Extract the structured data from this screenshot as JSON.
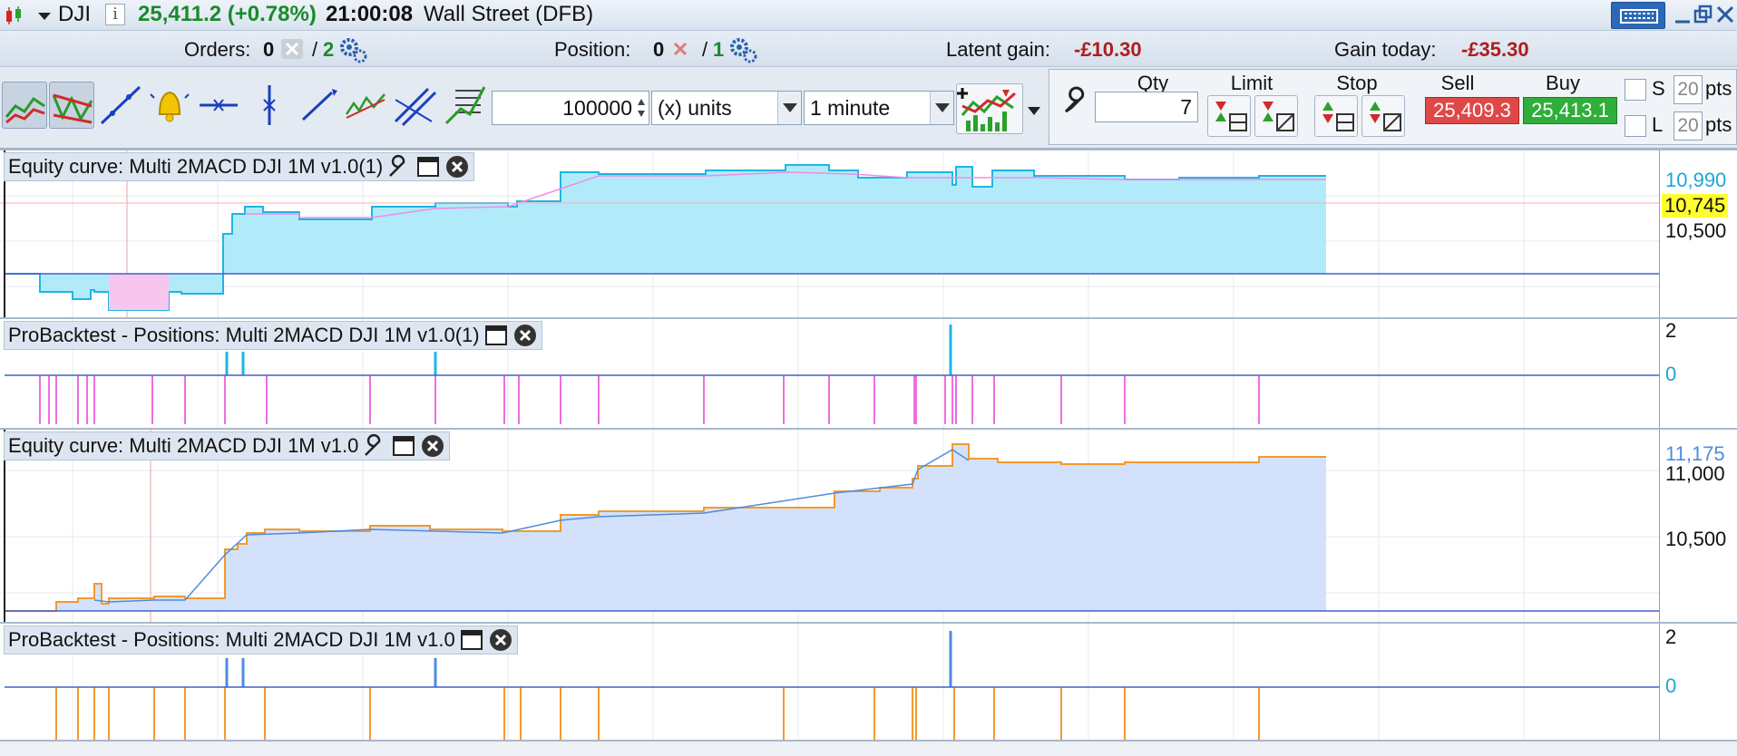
{
  "titlebar": {
    "symbol": "DJI",
    "price_change": "25,411.2 (+0.78%)",
    "time": "21:00:08",
    "market": "Wall Street (DFB)"
  },
  "infobar": {
    "orders_label": "Orders:",
    "orders_value": "0",
    "orders_sep": "/",
    "orders_auto": "2",
    "position_label": "Position:",
    "position_value": "0",
    "position_sep": "/",
    "position_auto": "1",
    "latent_label": "Latent gain:",
    "latent_value": "-£10.30",
    "gain_today_label": "Gain today:",
    "gain_today_value": "-£35.30"
  },
  "toolbar": {
    "quantity_value": "100000",
    "units_select": "(x) units",
    "timeframe_select": "1 minute",
    "order": {
      "qty_label": "Qty",
      "qty_value": "7",
      "limit_label": "Limit",
      "stop_label": "Stop",
      "sell_label": "Sell",
      "buy_label": "Buy",
      "sell_price": "25,409.3",
      "buy_price": "25,413.1",
      "s_label": "S",
      "l_label": "L",
      "s_pts": "20",
      "l_pts": "20",
      "pts_label": "pts"
    }
  },
  "panels": {
    "equity1": {
      "title": "Equity curve: Multi 2MACD DJI 1M v1.0(1)",
      "axis_top": "10,990",
      "axis_mark": "10,745",
      "axis_mid": "10,500"
    },
    "positions1": {
      "title": "ProBacktest - Positions: Multi 2MACD DJI 1M v1.0(1)",
      "axis_top": "2",
      "axis_zero": "0"
    },
    "equity2": {
      "title": "Equity curve: Multi 2MACD DJI 1M v1.0",
      "axis_top": "11,175",
      "axis_mid": "11,000",
      "axis_low": "10,500"
    },
    "positions2": {
      "title": "ProBacktest - Positions: Multi 2MACD DJI 1M v1.0",
      "axis_top": "2",
      "axis_zero": "0"
    }
  },
  "colors": {
    "equity1_line": "#1fb5e6",
    "equity1_fill": "#b1ebfa",
    "equity1_neg": "#f08ce4",
    "equity2_line": "#f29a2e",
    "equity2_fill": "#d3e2fa",
    "pos1_marker": "#ee6ee0",
    "pos2_marker": "#f29a2e",
    "baseline": "#4060d0"
  }
}
